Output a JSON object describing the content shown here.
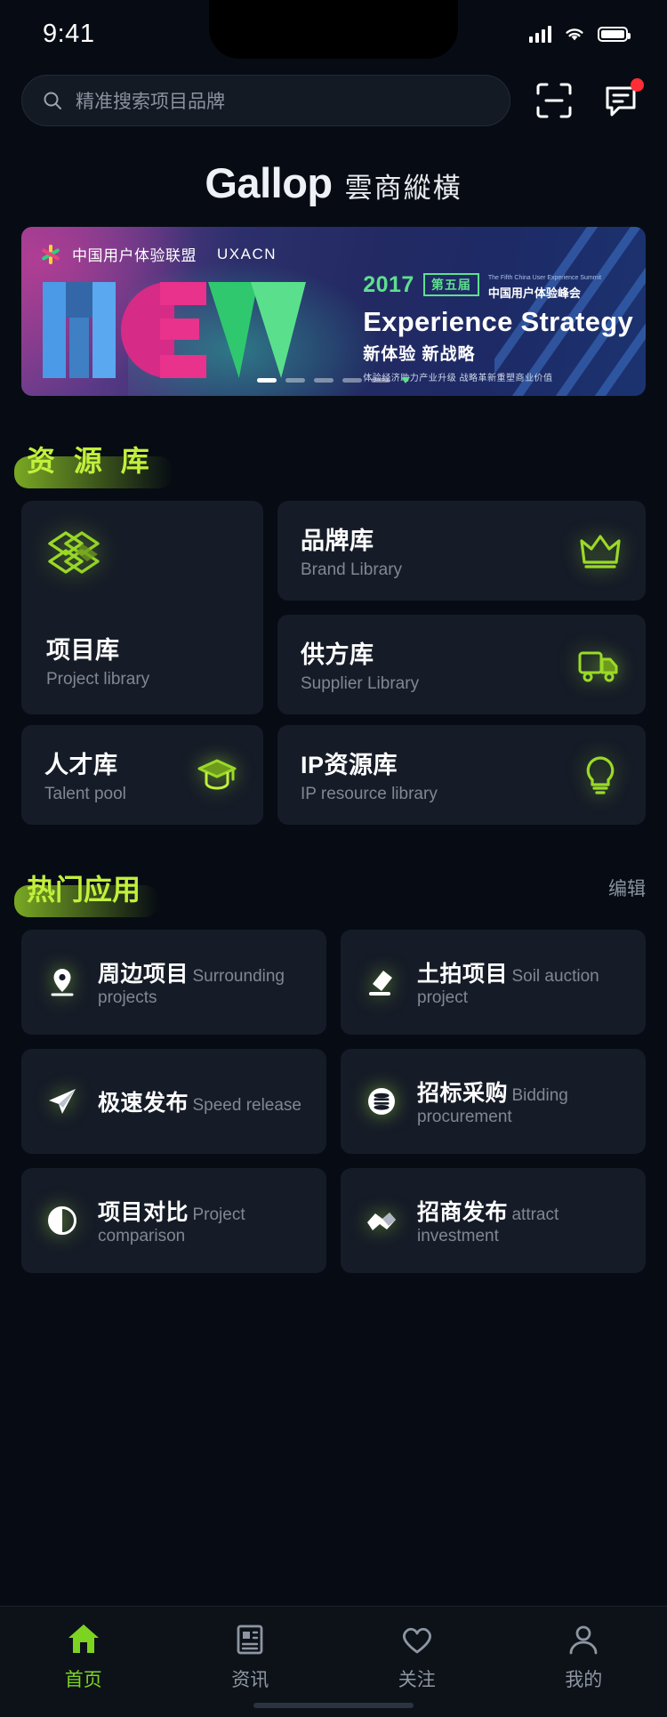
{
  "status_bar": {
    "time": "9:41",
    "signal_icon": "signal-bars-icon",
    "wifi_icon": "wifi-icon",
    "battery_icon": "battery-icon"
  },
  "search": {
    "placeholder": "精准搜索项目品牌",
    "search_icon": "search-icon",
    "scan_icon": "scan-icon",
    "message_icon": "message-icon",
    "has_unread": true
  },
  "brand": {
    "name_en": "Gallop",
    "name_cn": "雲商縱橫"
  },
  "banner": {
    "org_cn": "中国用户体验联盟",
    "org_en": "UXACN",
    "word": "NEW",
    "year": "2017",
    "edition_badge": "第五届",
    "summit_en_small": "The Fifth China User Experience Summit",
    "summit_cn_small": "中国用户体验峰会",
    "title_en": "Experience Strategy",
    "title_cn": "新体验 新战略",
    "desc_cn": "体验经济助力产业升级  战略革新重塑商业价值",
    "dots_total": 5,
    "dots_active": 1
  },
  "resource_section": {
    "title": "资 源 库",
    "cards": [
      {
        "title": "项目库",
        "subtitle": "Project library",
        "icon": "layers-icon"
      },
      {
        "title": "品牌库",
        "subtitle": "Brand Library",
        "icon": "crown-icon"
      },
      {
        "title": "供方库",
        "subtitle": "Supplier Library",
        "icon": "truck-icon"
      },
      {
        "title": "人才库",
        "subtitle": "Talent pool",
        "icon": "graduation-cap-icon"
      },
      {
        "title": "IP资源库",
        "subtitle": "IP resource library",
        "icon": "lightbulb-icon"
      }
    ]
  },
  "apps_section": {
    "title": "热门应用",
    "action": "编辑",
    "apps": [
      {
        "title": "周边项目",
        "subtitle": "Surrounding projects",
        "icon": "location-pin-icon"
      },
      {
        "title": "土拍项目",
        "subtitle": "Soil auction project",
        "icon": "gavel-icon"
      },
      {
        "title": "极速发布",
        "subtitle": "Speed release",
        "icon": "paper-plane-icon"
      },
      {
        "title": "招标采购",
        "subtitle": "Bidding procurement",
        "icon": "coins-icon"
      },
      {
        "title": "项目对比",
        "subtitle": "Project comparison",
        "icon": "contrast-circle-icon"
      },
      {
        "title": "招商发布",
        "subtitle": "attract investment",
        "icon": "handshake-icon"
      }
    ]
  },
  "tabbar": {
    "items": [
      {
        "label": "首页",
        "icon": "home-icon",
        "active": true
      },
      {
        "label": "资讯",
        "icon": "news-icon",
        "active": false
      },
      {
        "label": "关注",
        "icon": "heart-icon",
        "active": false
      },
      {
        "label": "我的",
        "icon": "person-icon",
        "active": false
      }
    ]
  },
  "colors": {
    "accent_green": "#c2f03c",
    "tab_active": "#7dd420",
    "background": "#070c14",
    "card": "#161c27",
    "badge_red": "#ff2d35"
  }
}
